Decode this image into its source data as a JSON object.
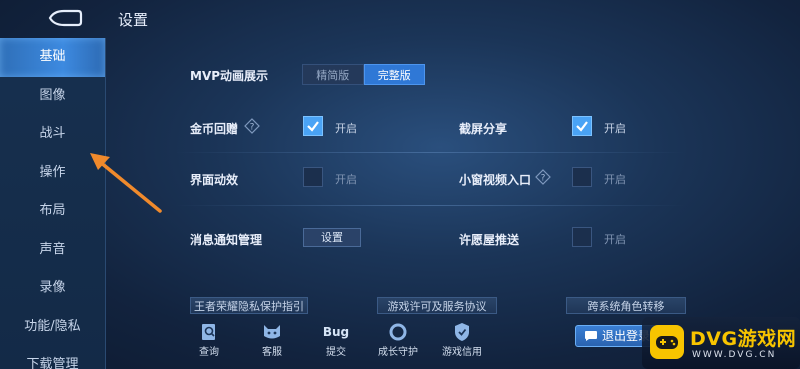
{
  "page_title": "设置",
  "sidebar": {
    "items": [
      {
        "label": "基础",
        "active": true
      },
      {
        "label": "图像",
        "active": false
      },
      {
        "label": "战斗",
        "active": false
      },
      {
        "label": "操作",
        "active": false
      },
      {
        "label": "布局",
        "active": false
      },
      {
        "label": "声音",
        "active": false
      },
      {
        "label": "录像",
        "active": false
      },
      {
        "label": "功能/隐私",
        "active": false
      },
      {
        "label": "下载管理",
        "active": false
      }
    ]
  },
  "settings": {
    "mvp": {
      "label": "MVP动画展示",
      "options": [
        "精简版",
        "完整版"
      ],
      "selected": "完整版"
    },
    "coin_gift": {
      "label": "金币回赠",
      "state_label": "开启",
      "checked": true
    },
    "screenshot_share": {
      "label": "截屏分享",
      "state_label": "开启",
      "checked": true
    },
    "ui_effects": {
      "label": "界面动效",
      "state_label": "开启",
      "checked": false
    },
    "mini_video": {
      "label": "小窗视频入口",
      "state_label": "开启",
      "checked": false
    },
    "notifications": {
      "label": "消息通知管理",
      "button_label": "设置"
    },
    "wish_push": {
      "label": "许愿屋推送",
      "state_label": "开启",
      "checked": false
    }
  },
  "links": {
    "privacy": "王者荣耀隐私保护指引",
    "license": "游戏许可及服务协议",
    "transfer": "跨系统角色转移"
  },
  "bottom_bar": {
    "query": "查询",
    "service": "客服",
    "bug_icon_text": "Bug",
    "submit": "提交",
    "growth": "成长守护",
    "credit": "游戏信用",
    "logout": "退出登录"
  },
  "watermark": {
    "title": "DVG游戏网",
    "url": "WWW.DVG.CN"
  },
  "colors": {
    "accent": "#3d8ae0",
    "checkbox_on": "#4aa3f5",
    "watermark": "#f7c400"
  }
}
